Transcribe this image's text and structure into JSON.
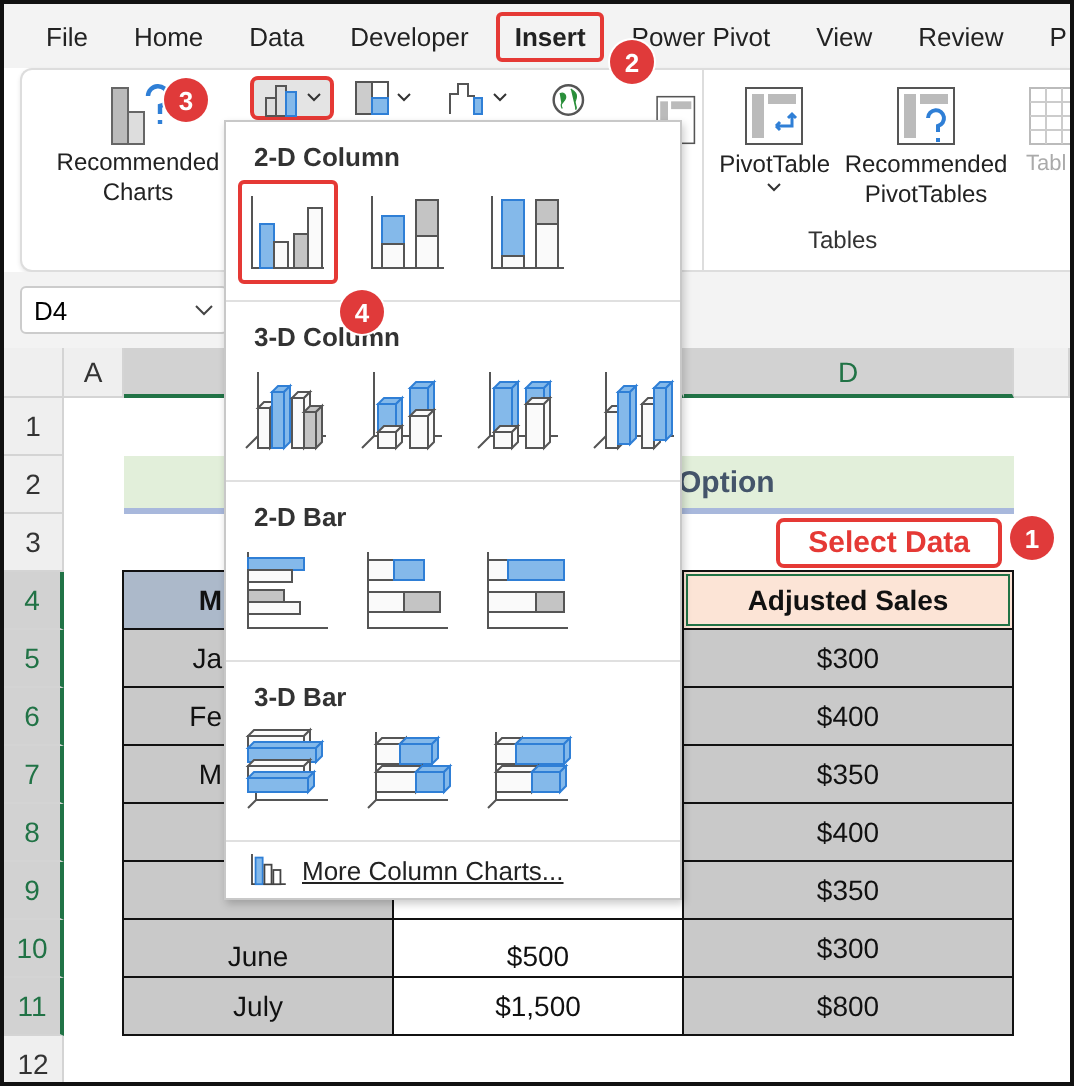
{
  "ribbon_tabs": [
    {
      "label": "File",
      "selected": false
    },
    {
      "label": "Home",
      "selected": false
    },
    {
      "label": "Data",
      "selected": false
    },
    {
      "label": "Developer",
      "selected": false
    },
    {
      "label": "Insert",
      "selected": true
    },
    {
      "label": "Power Pivot",
      "selected": false
    },
    {
      "label": "View",
      "selected": false
    },
    {
      "label": "Review",
      "selected": false
    },
    {
      "label": "P",
      "selected": false
    }
  ],
  "ribbon": {
    "recommended_charts": "Recommended Charts",
    "column_chart_pressed": true,
    "pivot_table": "PivotTable",
    "recommended_pivot_tables": "Recommended PivotTables",
    "table": "Tabl",
    "group_label": "Tables"
  },
  "name_box": "D4",
  "columns": [
    "A",
    "D"
  ],
  "row_numbers": [
    "1",
    "2",
    "3",
    "4",
    "5",
    "6",
    "7",
    "8",
    "9",
    "10",
    "11",
    "12"
  ],
  "sheet_title": "Option",
  "select_data": "Select Data",
  "table_rows": [
    {
      "kind": "header",
      "month": "M",
      "adjusted": "Adjusted Sales"
    },
    {
      "kind": "data",
      "month": "Ja",
      "adjusted": "$300"
    },
    {
      "kind": "data",
      "month": "Fe",
      "adjusted": "$400"
    },
    {
      "kind": "data",
      "month": "M",
      "adjusted": "$350"
    },
    {
      "kind": "data",
      "adjusted": "$400"
    },
    {
      "kind": "data",
      "adjusted": "$350"
    },
    {
      "kind": "data",
      "month": "June",
      "sales": "$500",
      "adjusted": "$300"
    },
    {
      "kind": "data",
      "month": "July",
      "sales": "$1,500",
      "adjusted": "$800"
    }
  ],
  "chart_menu": {
    "sections": [
      {
        "title": "2-D Column",
        "kind": "column2d",
        "items": [
          {
            "selected": true
          },
          {
            "selected": false
          },
          {
            "selected": false
          }
        ]
      },
      {
        "title": "3-D Column",
        "kind": "column3d",
        "items": [
          {
            "selected": false
          },
          {
            "selected": false
          },
          {
            "selected": false
          },
          {
            "selected": false
          }
        ]
      },
      {
        "title": "2-D Bar",
        "kind": "bar2d",
        "items": [
          {
            "selected": false
          },
          {
            "selected": false
          },
          {
            "selected": false
          }
        ]
      },
      {
        "title": "3-D Bar",
        "kind": "bar3d",
        "items": [
          {
            "selected": false
          },
          {
            "selected": false
          },
          {
            "selected": false
          }
        ]
      }
    ],
    "more": "More Column Charts..."
  },
  "badges": [
    "1",
    "2",
    "3",
    "4"
  ]
}
